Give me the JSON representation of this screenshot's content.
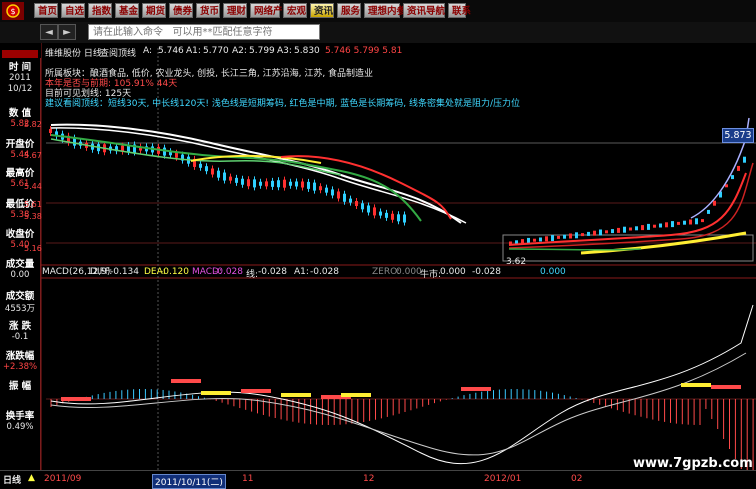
{
  "menu": [
    "首页",
    "自选",
    "指数",
    "基金",
    "期货",
    "债券",
    "货币",
    "理财",
    "网络产",
    "宏观",
    "资讯",
    "服务",
    "理想内参",
    "资讯导航",
    "联系"
  ],
  "menu_active": 10,
  "nav": {
    "back": "◄",
    "forward": "►",
    "refresh": "↻"
  },
  "command_input": {
    "placeholder": "请在此输入命令   可以用**匹配任意字符"
  },
  "price_header": {
    "name": "维维股份 日线",
    "indicator": "查阅顶线",
    "a_label": "A:",
    "a_value": "5.746",
    "a1_label": "A1:",
    "a1_value": "5.770",
    "a2_label": "A2:",
    "a2_value": "5.799",
    "a3_label": "A3:",
    "a3_value": "5.830",
    "tail_values": "5.746  5.799  5.81"
  },
  "info_lines": [
    {
      "text": "所属板块：酿酒食品, 低价, 农业龙头, 创投, 长江三角, 江苏沿海, 江苏, 食品制造业",
      "color": "#e8e8e8"
    },
    {
      "text": "本年是否与前期: 105.91%   44天",
      "color": "#ff4a4a"
    },
    {
      "text": "目前可见划线: 125天",
      "color": "#e8e8e8"
    },
    {
      "text": "建议看阅顶线：短线30天, 中长线120天! 浅色线是短期筹码, 红色是中期, 蓝色是长期筹码, 线条密集处就是阻力/压力位",
      "color": "#3fd8ff"
    }
  ],
  "sidebar": {
    "items": [
      {
        "label": "时 间",
        "value": "2011",
        "value2": "10/12"
      },
      {
        "label": "数 值",
        "value": "5.82"
      },
      {
        "label": "开盘价",
        "value": "5.44"
      },
      {
        "label": "最高价",
        "value": "5.61"
      },
      {
        "label": "最低价",
        "value": "5.38"
      },
      {
        "label": "收盘价",
        "value": "5.40"
      },
      {
        "label": "成交量",
        "value": "0.00"
      },
      {
        "label": "成交额",
        "value": "4553万"
      },
      {
        "label": "涨 跌",
        "value": "-0.1"
      },
      {
        "label": "涨跌幅",
        "value": "+2.38%"
      },
      {
        "label": "振 幅",
        "value": ""
      },
      {
        "label": "换手率",
        "value": "0.49%"
      }
    ]
  },
  "price_axis_labels": [
    "5.82",
    "5.67",
    "5.44",
    "5.61",
    "5.38",
    "5.16"
  ],
  "current_price": "5.873",
  "low_label": "3.62",
  "macd_header": {
    "name": "MACD(26,12,9)",
    "diff_label": "DIFF:",
    "diff": "-0.134",
    "dea_label": "DEA:",
    "dea": "-0.120",
    "macd_label": "MACD:",
    "macd": "-0.028",
    "line_label": "线:",
    "line": "-0.028",
    "a1_label": "A1:",
    "a1": "-0.028",
    "zero_label": "ZERO:",
    "zero": "0.000",
    "bull_label": "牛市:",
    "bull": "0.000",
    "bull2": "-0.028",
    "tail": "0.000"
  },
  "dates": {
    "d1": "2011/09",
    "d2": "2011/10/11(二)",
    "d3": "11",
    "d4": "12",
    "d5": "2012/01",
    "d6": "02"
  },
  "bottom_tab": "日线",
  "watermark": "www.7gpzb.com",
  "colors": {
    "up": "#ff3030",
    "down": "#2fd0ff",
    "ma_white": "#ffffff",
    "ma_yellow": "#ffee33",
    "ma_green": "#33aa44",
    "axis_red": "#8a1a1a"
  }
}
